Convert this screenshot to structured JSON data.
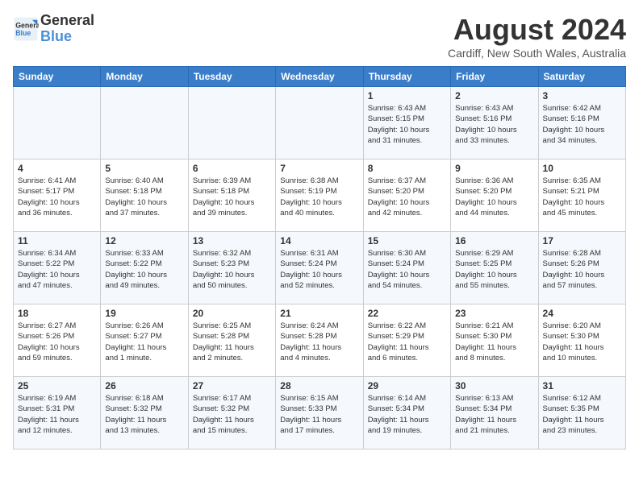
{
  "header": {
    "logo_line1": "General",
    "logo_line2": "Blue",
    "month_year": "August 2024",
    "location": "Cardiff, New South Wales, Australia"
  },
  "days_of_week": [
    "Sunday",
    "Monday",
    "Tuesday",
    "Wednesday",
    "Thursday",
    "Friday",
    "Saturday"
  ],
  "weeks": [
    [
      {
        "day": "",
        "info": ""
      },
      {
        "day": "",
        "info": ""
      },
      {
        "day": "",
        "info": ""
      },
      {
        "day": "",
        "info": ""
      },
      {
        "day": "1",
        "info": "Sunrise: 6:43 AM\nSunset: 5:15 PM\nDaylight: 10 hours\nand 31 minutes."
      },
      {
        "day": "2",
        "info": "Sunrise: 6:43 AM\nSunset: 5:16 PM\nDaylight: 10 hours\nand 33 minutes."
      },
      {
        "day": "3",
        "info": "Sunrise: 6:42 AM\nSunset: 5:16 PM\nDaylight: 10 hours\nand 34 minutes."
      }
    ],
    [
      {
        "day": "4",
        "info": "Sunrise: 6:41 AM\nSunset: 5:17 PM\nDaylight: 10 hours\nand 36 minutes."
      },
      {
        "day": "5",
        "info": "Sunrise: 6:40 AM\nSunset: 5:18 PM\nDaylight: 10 hours\nand 37 minutes."
      },
      {
        "day": "6",
        "info": "Sunrise: 6:39 AM\nSunset: 5:18 PM\nDaylight: 10 hours\nand 39 minutes."
      },
      {
        "day": "7",
        "info": "Sunrise: 6:38 AM\nSunset: 5:19 PM\nDaylight: 10 hours\nand 40 minutes."
      },
      {
        "day": "8",
        "info": "Sunrise: 6:37 AM\nSunset: 5:20 PM\nDaylight: 10 hours\nand 42 minutes."
      },
      {
        "day": "9",
        "info": "Sunrise: 6:36 AM\nSunset: 5:20 PM\nDaylight: 10 hours\nand 44 minutes."
      },
      {
        "day": "10",
        "info": "Sunrise: 6:35 AM\nSunset: 5:21 PM\nDaylight: 10 hours\nand 45 minutes."
      }
    ],
    [
      {
        "day": "11",
        "info": "Sunrise: 6:34 AM\nSunset: 5:22 PM\nDaylight: 10 hours\nand 47 minutes."
      },
      {
        "day": "12",
        "info": "Sunrise: 6:33 AM\nSunset: 5:22 PM\nDaylight: 10 hours\nand 49 minutes."
      },
      {
        "day": "13",
        "info": "Sunrise: 6:32 AM\nSunset: 5:23 PM\nDaylight: 10 hours\nand 50 minutes."
      },
      {
        "day": "14",
        "info": "Sunrise: 6:31 AM\nSunset: 5:24 PM\nDaylight: 10 hours\nand 52 minutes."
      },
      {
        "day": "15",
        "info": "Sunrise: 6:30 AM\nSunset: 5:24 PM\nDaylight: 10 hours\nand 54 minutes."
      },
      {
        "day": "16",
        "info": "Sunrise: 6:29 AM\nSunset: 5:25 PM\nDaylight: 10 hours\nand 55 minutes."
      },
      {
        "day": "17",
        "info": "Sunrise: 6:28 AM\nSunset: 5:26 PM\nDaylight: 10 hours\nand 57 minutes."
      }
    ],
    [
      {
        "day": "18",
        "info": "Sunrise: 6:27 AM\nSunset: 5:26 PM\nDaylight: 10 hours\nand 59 minutes."
      },
      {
        "day": "19",
        "info": "Sunrise: 6:26 AM\nSunset: 5:27 PM\nDaylight: 11 hours\nand 1 minute."
      },
      {
        "day": "20",
        "info": "Sunrise: 6:25 AM\nSunset: 5:28 PM\nDaylight: 11 hours\nand 2 minutes."
      },
      {
        "day": "21",
        "info": "Sunrise: 6:24 AM\nSunset: 5:28 PM\nDaylight: 11 hours\nand 4 minutes."
      },
      {
        "day": "22",
        "info": "Sunrise: 6:22 AM\nSunset: 5:29 PM\nDaylight: 11 hours\nand 6 minutes."
      },
      {
        "day": "23",
        "info": "Sunrise: 6:21 AM\nSunset: 5:30 PM\nDaylight: 11 hours\nand 8 minutes."
      },
      {
        "day": "24",
        "info": "Sunrise: 6:20 AM\nSunset: 5:30 PM\nDaylight: 11 hours\nand 10 minutes."
      }
    ],
    [
      {
        "day": "25",
        "info": "Sunrise: 6:19 AM\nSunset: 5:31 PM\nDaylight: 11 hours\nand 12 minutes."
      },
      {
        "day": "26",
        "info": "Sunrise: 6:18 AM\nSunset: 5:32 PM\nDaylight: 11 hours\nand 13 minutes."
      },
      {
        "day": "27",
        "info": "Sunrise: 6:17 AM\nSunset: 5:32 PM\nDaylight: 11 hours\nand 15 minutes."
      },
      {
        "day": "28",
        "info": "Sunrise: 6:15 AM\nSunset: 5:33 PM\nDaylight: 11 hours\nand 17 minutes."
      },
      {
        "day": "29",
        "info": "Sunrise: 6:14 AM\nSunset: 5:34 PM\nDaylight: 11 hours\nand 19 minutes."
      },
      {
        "day": "30",
        "info": "Sunrise: 6:13 AM\nSunset: 5:34 PM\nDaylight: 11 hours\nand 21 minutes."
      },
      {
        "day": "31",
        "info": "Sunrise: 6:12 AM\nSunset: 5:35 PM\nDaylight: 11 hours\nand 23 minutes."
      }
    ]
  ]
}
